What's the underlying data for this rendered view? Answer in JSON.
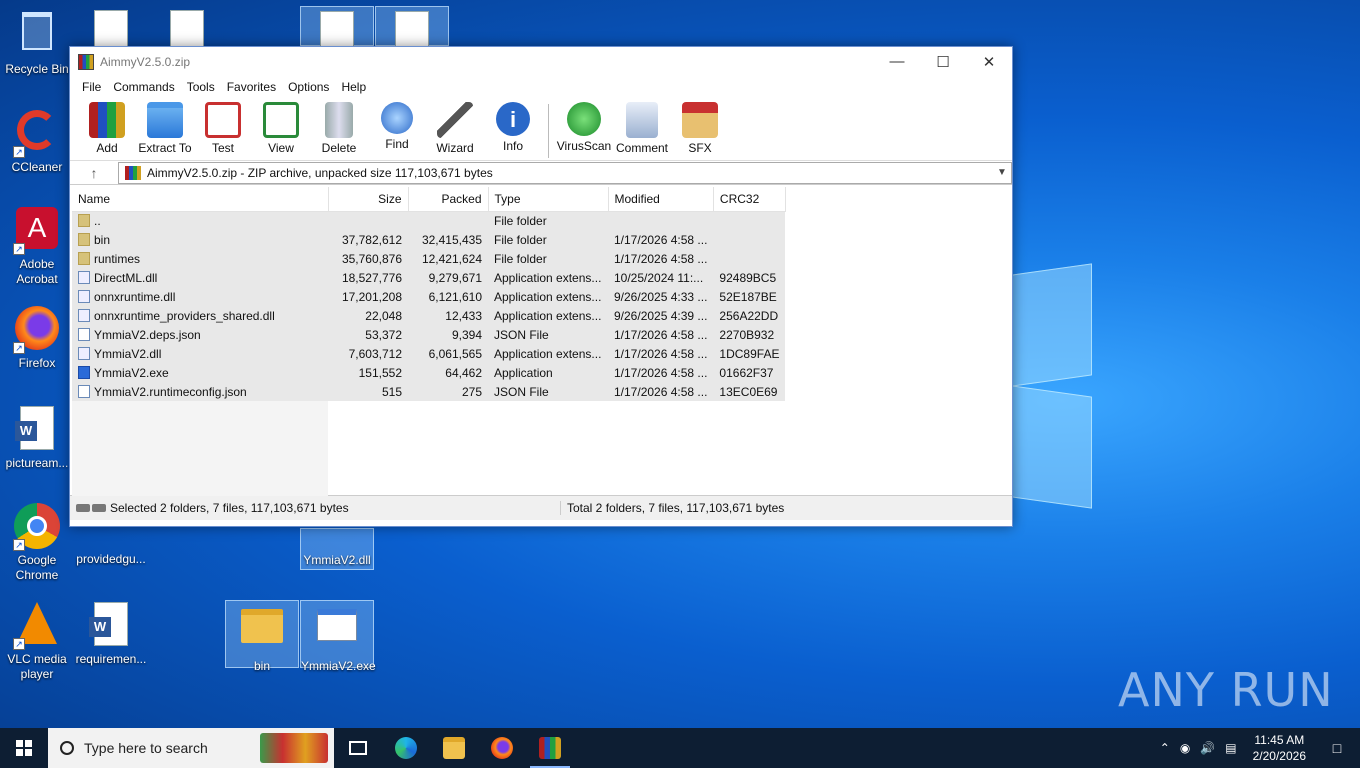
{
  "desktop": {
    "icons": [
      {
        "label": "Recycle Bin"
      },
      {
        "label": "CCleaner"
      },
      {
        "label": "Adobe Acrobat"
      },
      {
        "label": "Firefox"
      },
      {
        "label": "pictuream..."
      },
      {
        "label": "Google Chrome"
      },
      {
        "label": "VLC media player"
      },
      {
        "label": "providedgu..."
      },
      {
        "label": "requiremen..."
      },
      {
        "label": "YmmiaV2.dll"
      },
      {
        "label": "bin"
      },
      {
        "label": "YmmiaV2.exe"
      }
    ],
    "watermark": "ANY RUN"
  },
  "window": {
    "title": "AimmyV2.5.0.zip",
    "menu": [
      "File",
      "Commands",
      "Tools",
      "Favorites",
      "Options",
      "Help"
    ],
    "toolbar": [
      {
        "label": "Add",
        "icon": "add-archive-icon"
      },
      {
        "label": "Extract To",
        "icon": "extract-folder-icon"
      },
      {
        "label": "Test",
        "icon": "test-clipboard-icon"
      },
      {
        "label": "View",
        "icon": "view-book-icon"
      },
      {
        "label": "Delete",
        "icon": "trash-icon"
      },
      {
        "label": "Find",
        "icon": "magnifier-icon"
      },
      {
        "label": "Wizard",
        "icon": "wand-icon"
      },
      {
        "label": "Info",
        "icon": "info-icon"
      },
      {
        "label": "VirusScan",
        "icon": "bug-scan-icon"
      },
      {
        "label": "Comment",
        "icon": "comment-icon"
      },
      {
        "label": "SFX",
        "icon": "sfx-box-icon"
      }
    ],
    "address": "AimmyV2.5.0.zip - ZIP archive, unpacked size 117,103,671 bytes",
    "columns": {
      "name": "Name",
      "size": "Size",
      "packed": "Packed",
      "type": "Type",
      "modified": "Modified",
      "crc": "CRC32"
    },
    "files": [
      {
        "name": "..",
        "size": "",
        "packed": "",
        "type": "File folder",
        "modified": "",
        "crc": "",
        "kind": "folder"
      },
      {
        "name": "bin",
        "size": "37,782,612",
        "packed": "32,415,435",
        "type": "File folder",
        "modified": "1/17/2026 4:58 ...",
        "crc": "",
        "kind": "folder"
      },
      {
        "name": "runtimes",
        "size": "35,760,876",
        "packed": "12,421,624",
        "type": "File folder",
        "modified": "1/17/2026 4:58 ...",
        "crc": "",
        "kind": "folder"
      },
      {
        "name": "DirectML.dll",
        "size": "18,527,776",
        "packed": "9,279,671",
        "type": "Application extens...",
        "modified": "10/25/2024 11:...",
        "crc": "92489BC5",
        "kind": "dll"
      },
      {
        "name": "onnxruntime.dll",
        "size": "17,201,208",
        "packed": "6,121,610",
        "type": "Application extens...",
        "modified": "9/26/2025 4:33 ...",
        "crc": "52E187BE",
        "kind": "dll"
      },
      {
        "name": "onnxruntime_providers_shared.dll",
        "size": "22,048",
        "packed": "12,433",
        "type": "Application extens...",
        "modified": "9/26/2025 4:39 ...",
        "crc": "256A22DD",
        "kind": "dll"
      },
      {
        "name": "YmmiaV2.deps.json",
        "size": "53,372",
        "packed": "9,394",
        "type": "JSON File",
        "modified": "1/17/2026 4:58 ...",
        "crc": "2270B932",
        "kind": "file"
      },
      {
        "name": "YmmiaV2.dll",
        "size": "7,603,712",
        "packed": "6,061,565",
        "type": "Application extens...",
        "modified": "1/17/2026 4:58 ...",
        "crc": "1DC89FAE",
        "kind": "dll"
      },
      {
        "name": "YmmiaV2.exe",
        "size": "151,552",
        "packed": "64,462",
        "type": "Application",
        "modified": "1/17/2026 4:58 ...",
        "crc": "01662F37",
        "kind": "exe"
      },
      {
        "name": "YmmiaV2.runtimeconfig.json",
        "size": "515",
        "packed": "275",
        "type": "JSON File",
        "modified": "1/17/2026 4:58 ...",
        "crc": "13EC0E69",
        "kind": "file"
      }
    ],
    "status_left": "Selected 2 folders, 7 files, 117,103,671 bytes",
    "status_right": "Total 2 folders, 7 files, 117,103,671 bytes"
  },
  "taskbar": {
    "search_placeholder": "Type here to search",
    "time": "11:45 AM",
    "date": "2/20/2026"
  }
}
